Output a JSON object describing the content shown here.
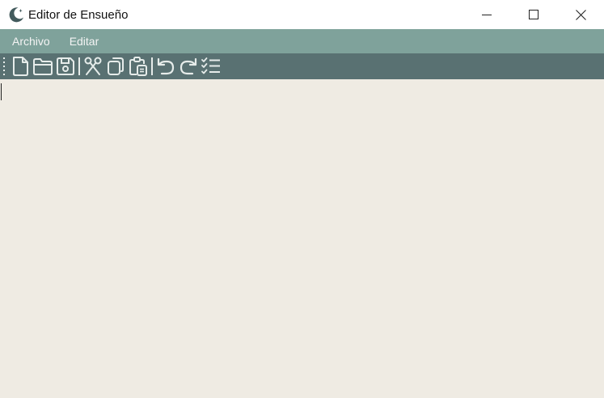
{
  "window": {
    "title": "Editor de Ensueño",
    "app_icon": "moon-icon",
    "controls": [
      "minimize-icon",
      "maximize-icon",
      "close-icon"
    ]
  },
  "menu": {
    "items": [
      {
        "label": "Archivo"
      },
      {
        "label": "Editar"
      }
    ]
  },
  "toolbar": {
    "buttons": [
      {
        "icon": "new-file-icon",
        "label": "Nuevo"
      },
      {
        "icon": "open-folder-icon",
        "label": "Abrir"
      },
      {
        "icon": "save-icon",
        "label": "Guardar"
      },
      {
        "icon": "cut-icon",
        "label": "Cortar"
      },
      {
        "icon": "copy-icon",
        "label": "Copiar"
      },
      {
        "icon": "paste-icon",
        "label": "Pegar"
      },
      {
        "icon": "undo-icon",
        "label": "Deshacer"
      },
      {
        "icon": "redo-icon",
        "label": "Rehacer"
      },
      {
        "icon": "checklist-icon",
        "label": "Lista"
      }
    ]
  },
  "editor": {
    "content": ""
  },
  "colors": {
    "menubar": "#7fa29b",
    "toolbar": "#597172",
    "editor_bg": "#efebe3",
    "icon_stroke": "#e6ecea",
    "app_icon": "#425a5c"
  }
}
